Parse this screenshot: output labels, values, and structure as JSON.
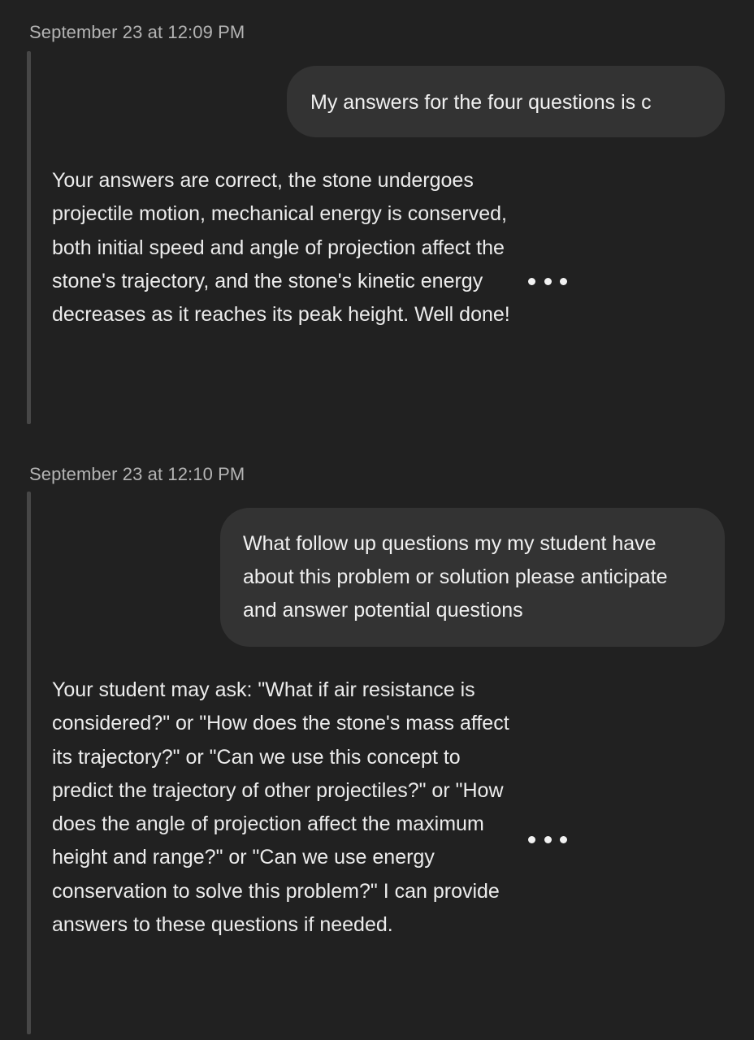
{
  "conversation": [
    {
      "timestamp": "September 23 at 12:09 PM",
      "user_message": "My answers for the four questions is c",
      "bot_message": "Your answers are correct, the stone undergoes projectile motion, mechanical energy is conserved, both initial speed and angle of projection affect the stone's trajectory, and the stone's kinetic energy decreases as it reaches its peak height. Well done!",
      "more_icon": "more-horizontal-icon"
    },
    {
      "timestamp": "September 23 at 12:10 PM",
      "user_message": "What follow up questions my my student have about this problem or solution please anticipate and answer potential questions",
      "bot_message": "Your student may ask: \"What if air resistance is considered?\" or \"How does the stone's mass affect its trajectory?\" or \"Can we use this concept to predict the trajectory of other projectiles?\" or \"How does the angle of projection affect the maximum height and range?\" or \"Can we use energy conservation to solve this problem?\" I can provide answers to these questions if needed.",
      "more_icon": "more-horizontal-icon"
    }
  ]
}
